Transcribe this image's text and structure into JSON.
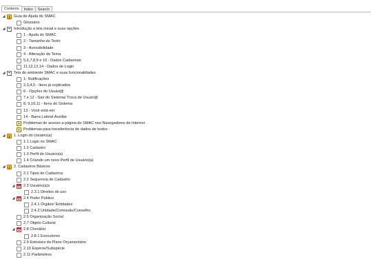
{
  "tabs": [
    "Contents",
    "Index",
    "Search"
  ],
  "tree": [
    {
      "label": "Guia de Ajuda do SMAC",
      "level": 0,
      "icon": "book-icon",
      "toggle": "expanded"
    },
    {
      "label": "Glossário",
      "level": 1,
      "icon": "page-icon",
      "toggle": ""
    },
    {
      "label": "Introdução a tela inicial e suas opções",
      "level": 0,
      "icon": "page-text-icon",
      "toggle": "expanded"
    },
    {
      "label": "1 - Ajuda do SMAC",
      "level": 1,
      "icon": "page-icon",
      "toggle": ""
    },
    {
      "label": "2 - Tamanho do Texto",
      "level": 1,
      "icon": "page-icon",
      "toggle": ""
    },
    {
      "label": "3 - Acessibilidade",
      "level": 1,
      "icon": "page-icon",
      "toggle": ""
    },
    {
      "label": "4 - Alteração de Tema",
      "level": 1,
      "icon": "page-icon",
      "toggle": ""
    },
    {
      "label": "5,6,7,8,9 e 10 - Dados Cadastrais",
      "level": 1,
      "icon": "page-icon",
      "toggle": ""
    },
    {
      "label": "11,12,13,14 - Dados de Login",
      "level": 1,
      "icon": "page-icon",
      "toggle": ""
    },
    {
      "label": "Tela do ambiente SMAC e suas funcionalidades",
      "level": 0,
      "icon": "page-text-icon",
      "toggle": "expanded"
    },
    {
      "label": "1- Notificações",
      "level": 1,
      "icon": "page-icon",
      "toggle": ""
    },
    {
      "label": "2,3,4,5 - Itens já explicados",
      "level": 1,
      "icon": "page-icon",
      "toggle": ""
    },
    {
      "label": "6 - Opções do Usuári@",
      "level": 1,
      "icon": "page-icon",
      "toggle": ""
    },
    {
      "label": "7 e 12 - Sair do Sistema/ Troca de Usuári@",
      "level": 1,
      "icon": "page-icon",
      "toggle": ""
    },
    {
      "label": "8, 9,10,11 - Itens do Sistema",
      "level": 1,
      "icon": "page-icon",
      "toggle": ""
    },
    {
      "label": "13 - Você está em:",
      "level": 1,
      "icon": "page-icon",
      "toggle": ""
    },
    {
      "label": "14 - Barra Lateral Auxiliar",
      "level": 1,
      "icon": "page-icon",
      "toggle": ""
    },
    {
      "label": "Problemas de acesso a página do SMAC nos Navegadores de Internet",
      "level": 1,
      "icon": "warning-page-icon",
      "toggle": ""
    },
    {
      "label": "Problemas para transferência de dados de textos",
      "level": 1,
      "icon": "warning-page-icon",
      "toggle": ""
    },
    {
      "label": "1. Login do Usuário(a)",
      "level": 0,
      "icon": "book-icon",
      "toggle": "expanded"
    },
    {
      "label": "1.1 Login no SMAC",
      "level": 1,
      "icon": "page-icon",
      "toggle": ""
    },
    {
      "label": "1.2 Cadastro",
      "level": 1,
      "icon": "page-icon",
      "toggle": ""
    },
    {
      "label": "1.3 Perfil do Usuário(a)",
      "level": 1,
      "icon": "page-icon",
      "toggle": ""
    },
    {
      "label": "1.4 Criando um novo Perfil de Usuário(a)",
      "level": 1,
      "icon": "page-icon",
      "toggle": ""
    },
    {
      "label": "2. Cadastros Básicos",
      "level": 0,
      "icon": "book-icon",
      "toggle": "expanded"
    },
    {
      "label": "2.1 Tipos de Cadastros",
      "level": 1,
      "icon": "page-icon",
      "toggle": ""
    },
    {
      "label": "2.2 Sequencia de Cadastro",
      "level": 1,
      "icon": "page-icon",
      "toggle": ""
    },
    {
      "label": "2.3 Usuário(a)s",
      "level": 1,
      "icon": "red-page-icon",
      "toggle": "expanded"
    },
    {
      "label": "2.3.1 Direitos de uso",
      "level": 2,
      "icon": "page-icon",
      "toggle": ""
    },
    {
      "label": "2.4 Poder Público",
      "level": 1,
      "icon": "red-page-icon",
      "toggle": "expanded"
    },
    {
      "label": "2.4.1 Órgãos/ Entidades",
      "level": 2,
      "icon": "page-icon",
      "toggle": ""
    },
    {
      "label": "2.4.2 Unidade/Comissão/Conselho",
      "level": 2,
      "icon": "page-icon",
      "toggle": ""
    },
    {
      "label": "2.5 Organização Social",
      "level": 1,
      "icon": "page-icon",
      "toggle": ""
    },
    {
      "label": "2.7 Objeto Cultural",
      "level": 1,
      "icon": "page-icon",
      "toggle": ""
    },
    {
      "label": "2.8 Checklist",
      "level": 1,
      "icon": "red-page-icon",
      "toggle": "expanded"
    },
    {
      "label": "2.8.1 Executores",
      "level": 2,
      "icon": "page-icon",
      "toggle": ""
    },
    {
      "label": "2.9 Estrutura do Plano Orçamentário",
      "level": 1,
      "icon": "page-icon",
      "toggle": ""
    },
    {
      "label": "2.10 Espécie/Subspécie",
      "level": 1,
      "icon": "page-icon",
      "toggle": ""
    },
    {
      "label": "2.11 Parâmetros",
      "level": 1,
      "icon": "page-icon",
      "toggle": ""
    }
  ]
}
